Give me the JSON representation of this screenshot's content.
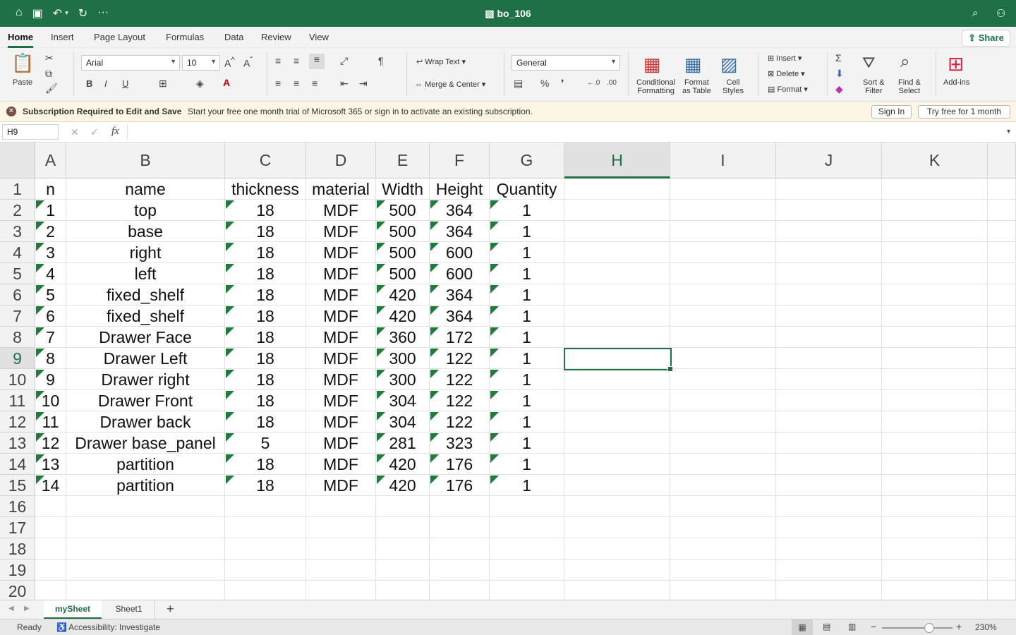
{
  "window": {
    "title": "bo_106"
  },
  "ribbon_tabs": [
    "Home",
    "Insert",
    "Page Layout",
    "Formulas",
    "Data",
    "Review",
    "View"
  ],
  "share_label": "Share",
  "ribbon": {
    "paste": "Paste",
    "font_name": "Arial",
    "font_size": "10",
    "wrap_text": "Wrap Text",
    "merge_center": "Merge & Center",
    "number_format": "General",
    "conditional_formatting": [
      "Conditional",
      "Formatting"
    ],
    "format_as_table": [
      "Format",
      "as Table"
    ],
    "cell_styles": [
      "Cell",
      "Styles"
    ],
    "insert": "Insert",
    "delete": "Delete",
    "format": "Format",
    "sort_filter": [
      "Sort &",
      "Filter"
    ],
    "find_select": [
      "Find &",
      "Select"
    ],
    "add_ins": "Add-ins"
  },
  "message_bar": {
    "title": "Subscription Required to Edit and Save",
    "text": "Start your free one month trial of Microsoft 365 or sign in to activate an existing subscription.",
    "sign_in": "Sign In",
    "try_free": "Try free for 1 month"
  },
  "formula_bar": {
    "name_box": "H9",
    "fx": "fx",
    "formula": ""
  },
  "columns": [
    "A",
    "B",
    "C",
    "D",
    "E",
    "F",
    "G",
    "H",
    "I",
    "J",
    "K"
  ],
  "selected_column": "H",
  "selected_row": "9",
  "rows": [
    "1",
    "2",
    "3",
    "4",
    "5",
    "6",
    "7",
    "8",
    "9",
    "10",
    "11",
    "12",
    "13",
    "14",
    "15",
    "16",
    "17",
    "18",
    "19",
    "20"
  ],
  "table": {
    "headers": [
      "n",
      "name",
      "thickness",
      "material",
      "Width",
      "Height",
      "Quantity"
    ],
    "rows": [
      [
        "1",
        "top",
        "18",
        "MDF",
        "500",
        "364",
        "1"
      ],
      [
        "2",
        "base",
        "18",
        "MDF",
        "500",
        "364",
        "1"
      ],
      [
        "3",
        "right",
        "18",
        "MDF",
        "500",
        "600",
        "1"
      ],
      [
        "4",
        "left",
        "18",
        "MDF",
        "500",
        "600",
        "1"
      ],
      [
        "5",
        "fixed_shelf",
        "18",
        "MDF",
        "420",
        "364",
        "1"
      ],
      [
        "6",
        "fixed_shelf",
        "18",
        "MDF",
        "420",
        "364",
        "1"
      ],
      [
        "7",
        "Drawer Face",
        "18",
        "MDF",
        "360",
        "172",
        "1"
      ],
      [
        "8",
        "Drawer Left",
        "18",
        "MDF",
        "300",
        "122",
        "1"
      ],
      [
        "9",
        "Drawer right",
        "18",
        "MDF",
        "300",
        "122",
        "1"
      ],
      [
        "10",
        "Drawer Front",
        "18",
        "MDF",
        "304",
        "122",
        "1"
      ],
      [
        "11",
        "Drawer back",
        "18",
        "MDF",
        "304",
        "122",
        "1"
      ],
      [
        "12",
        "Drawer base_panel",
        "5",
        "MDF",
        "281",
        "323",
        "1"
      ],
      [
        "13",
        "partition",
        "18",
        "MDF",
        "420",
        "176",
        "1"
      ],
      [
        "14",
        "partition",
        "18",
        "MDF",
        "420",
        "176",
        "1"
      ]
    ]
  },
  "sheets": [
    "mySheet",
    "Sheet1"
  ],
  "active_sheet": "mySheet",
  "status": {
    "ready": "Ready",
    "accessibility": "Accessibility: Investigate",
    "zoom": "230%"
  },
  "colors": {
    "accent": "#1e7145",
    "message_bg": "#fdf6e4",
    "triangle": "#1e7c3a"
  }
}
